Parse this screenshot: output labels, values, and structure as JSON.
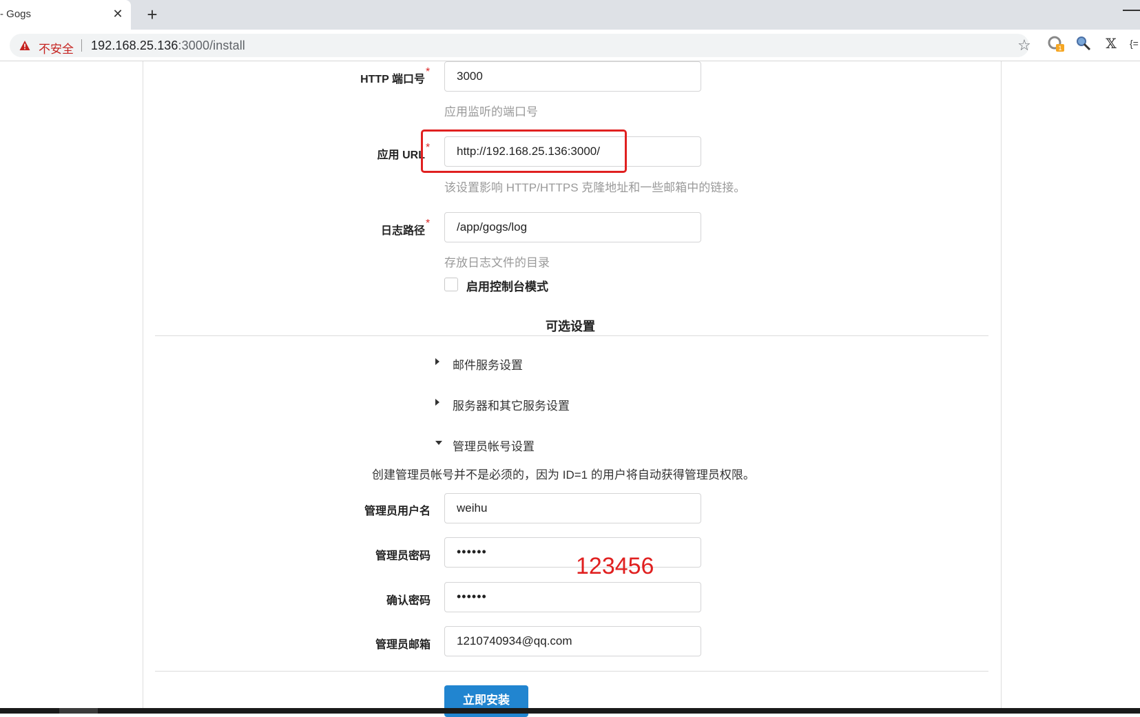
{
  "browser": {
    "tab_title": "- Gogs",
    "tab_close": "✕",
    "new_tab": "+",
    "insecure_label": "不安全",
    "url_host": "192.168.25.136",
    "url_rest": ":3000/install",
    "bookmark_icon": "star-icon",
    "extension_x_label": "𝕏",
    "extension_partial_label": "{="
  },
  "form": {
    "http_port": {
      "label": "HTTP 端口号",
      "required": "*",
      "value": "3000",
      "help": "应用监听的端口号"
    },
    "app_url": {
      "label": "应用 URL",
      "required": "*",
      "value": "http://192.168.25.136:3000/",
      "help": "该设置影响 HTTP/HTTPS 克隆地址和一些邮箱中的链接。"
    },
    "log_path": {
      "label": "日志路径",
      "required": "*",
      "value": "/app/gogs/log",
      "help": "存放日志文件的目录"
    },
    "console_mode": {
      "label": "启用控制台模式",
      "checked": false
    }
  },
  "optional": {
    "title": "可选设置",
    "sections": [
      {
        "label": "邮件服务设置",
        "expanded": false
      },
      {
        "label": "服务器和其它服务设置",
        "expanded": false
      },
      {
        "label": "管理员帐号设置",
        "expanded": true
      }
    ],
    "admin_note": "创建管理员帐号并不是必须的，因为 ID=1 的用户将自动获得管理员权限。",
    "admin": {
      "username_label": "管理员用户名",
      "username_value": "weihu",
      "password_label": "管理员密码",
      "password_value": "••••••",
      "confirm_label": "确认密码",
      "confirm_value": "••••••",
      "email_label": "管理员邮箱",
      "email_value": "1210740934@qq.com"
    }
  },
  "install_button": "立即安装",
  "annotation": {
    "password_hint": "123456",
    "color": "#e02020"
  },
  "colors": {
    "primary": "#2185d0",
    "required": "#db2828",
    "insecure": "#c5221f"
  }
}
